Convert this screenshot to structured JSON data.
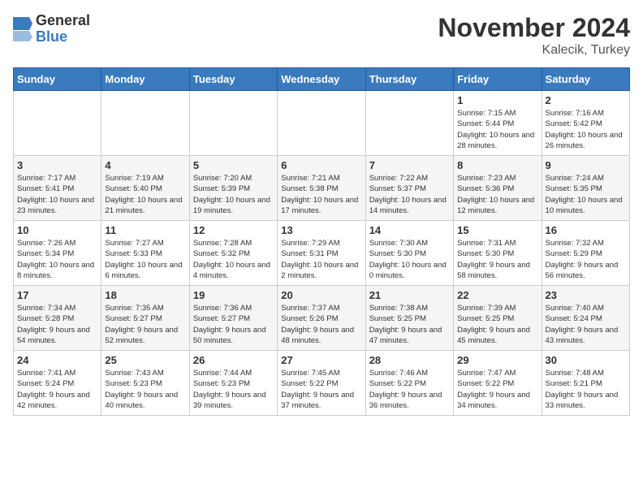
{
  "header": {
    "logo_general": "General",
    "logo_blue": "Blue",
    "month_title": "November 2024",
    "location": "Kalecik, Turkey"
  },
  "weekdays": [
    "Sunday",
    "Monday",
    "Tuesday",
    "Wednesday",
    "Thursday",
    "Friday",
    "Saturday"
  ],
  "weeks": [
    [
      {
        "day": "",
        "info": ""
      },
      {
        "day": "",
        "info": ""
      },
      {
        "day": "",
        "info": ""
      },
      {
        "day": "",
        "info": ""
      },
      {
        "day": "",
        "info": ""
      },
      {
        "day": "1",
        "info": "Sunrise: 7:15 AM\nSunset: 5:44 PM\nDaylight: 10 hours and 28 minutes."
      },
      {
        "day": "2",
        "info": "Sunrise: 7:16 AM\nSunset: 5:42 PM\nDaylight: 10 hours and 26 minutes."
      }
    ],
    [
      {
        "day": "3",
        "info": "Sunrise: 7:17 AM\nSunset: 5:41 PM\nDaylight: 10 hours and 23 minutes."
      },
      {
        "day": "4",
        "info": "Sunrise: 7:19 AM\nSunset: 5:40 PM\nDaylight: 10 hours and 21 minutes."
      },
      {
        "day": "5",
        "info": "Sunrise: 7:20 AM\nSunset: 5:39 PM\nDaylight: 10 hours and 19 minutes."
      },
      {
        "day": "6",
        "info": "Sunrise: 7:21 AM\nSunset: 5:38 PM\nDaylight: 10 hours and 17 minutes."
      },
      {
        "day": "7",
        "info": "Sunrise: 7:22 AM\nSunset: 5:37 PM\nDaylight: 10 hours and 14 minutes."
      },
      {
        "day": "8",
        "info": "Sunrise: 7:23 AM\nSunset: 5:36 PM\nDaylight: 10 hours and 12 minutes."
      },
      {
        "day": "9",
        "info": "Sunrise: 7:24 AM\nSunset: 5:35 PM\nDaylight: 10 hours and 10 minutes."
      }
    ],
    [
      {
        "day": "10",
        "info": "Sunrise: 7:26 AM\nSunset: 5:34 PM\nDaylight: 10 hours and 8 minutes."
      },
      {
        "day": "11",
        "info": "Sunrise: 7:27 AM\nSunset: 5:33 PM\nDaylight: 10 hours and 6 minutes."
      },
      {
        "day": "12",
        "info": "Sunrise: 7:28 AM\nSunset: 5:32 PM\nDaylight: 10 hours and 4 minutes."
      },
      {
        "day": "13",
        "info": "Sunrise: 7:29 AM\nSunset: 5:31 PM\nDaylight: 10 hours and 2 minutes."
      },
      {
        "day": "14",
        "info": "Sunrise: 7:30 AM\nSunset: 5:30 PM\nDaylight: 10 hours and 0 minutes."
      },
      {
        "day": "15",
        "info": "Sunrise: 7:31 AM\nSunset: 5:30 PM\nDaylight: 9 hours and 58 minutes."
      },
      {
        "day": "16",
        "info": "Sunrise: 7:32 AM\nSunset: 5:29 PM\nDaylight: 9 hours and 56 minutes."
      }
    ],
    [
      {
        "day": "17",
        "info": "Sunrise: 7:34 AM\nSunset: 5:28 PM\nDaylight: 9 hours and 54 minutes."
      },
      {
        "day": "18",
        "info": "Sunrise: 7:35 AM\nSunset: 5:27 PM\nDaylight: 9 hours and 52 minutes."
      },
      {
        "day": "19",
        "info": "Sunrise: 7:36 AM\nSunset: 5:27 PM\nDaylight: 9 hours and 50 minutes."
      },
      {
        "day": "20",
        "info": "Sunrise: 7:37 AM\nSunset: 5:26 PM\nDaylight: 9 hours and 48 minutes."
      },
      {
        "day": "21",
        "info": "Sunrise: 7:38 AM\nSunset: 5:25 PM\nDaylight: 9 hours and 47 minutes."
      },
      {
        "day": "22",
        "info": "Sunrise: 7:39 AM\nSunset: 5:25 PM\nDaylight: 9 hours and 45 minutes."
      },
      {
        "day": "23",
        "info": "Sunrise: 7:40 AM\nSunset: 5:24 PM\nDaylight: 9 hours and 43 minutes."
      }
    ],
    [
      {
        "day": "24",
        "info": "Sunrise: 7:41 AM\nSunset: 5:24 PM\nDaylight: 9 hours and 42 minutes."
      },
      {
        "day": "25",
        "info": "Sunrise: 7:43 AM\nSunset: 5:23 PM\nDaylight: 9 hours and 40 minutes."
      },
      {
        "day": "26",
        "info": "Sunrise: 7:44 AM\nSunset: 5:23 PM\nDaylight: 9 hours and 39 minutes."
      },
      {
        "day": "27",
        "info": "Sunrise: 7:45 AM\nSunset: 5:22 PM\nDaylight: 9 hours and 37 minutes."
      },
      {
        "day": "28",
        "info": "Sunrise: 7:46 AM\nSunset: 5:22 PM\nDaylight: 9 hours and 36 minutes."
      },
      {
        "day": "29",
        "info": "Sunrise: 7:47 AM\nSunset: 5:22 PM\nDaylight: 9 hours and 34 minutes."
      },
      {
        "day": "30",
        "info": "Sunrise: 7:48 AM\nSunset: 5:21 PM\nDaylight: 9 hours and 33 minutes."
      }
    ]
  ]
}
